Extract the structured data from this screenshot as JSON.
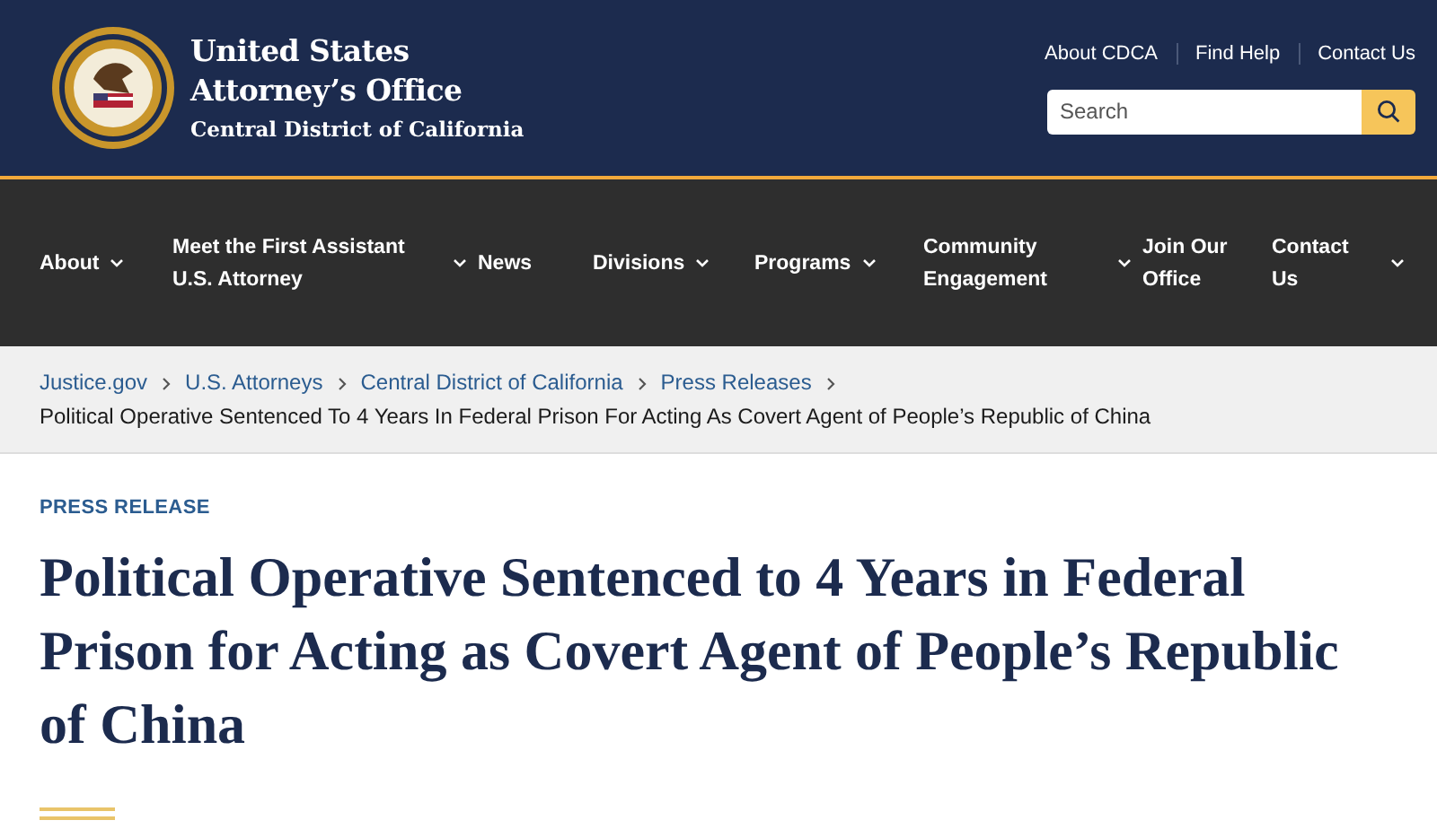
{
  "header": {
    "title_line_1": "United States",
    "title_line_2": "Attorney’s Office",
    "subtitle": "Central District of California",
    "utility_links": [
      "About CDCA",
      "Find Help",
      "Contact Us"
    ],
    "search": {
      "placeholder": "Search"
    }
  },
  "nav": [
    {
      "label": "About",
      "has_dropdown": true
    },
    {
      "label": "Meet the First Assistant U.S. Attorney",
      "has_dropdown": true
    },
    {
      "label": "News",
      "has_dropdown": false
    },
    {
      "label": "Divisions",
      "has_dropdown": true
    },
    {
      "label": "Programs",
      "has_dropdown": true
    },
    {
      "label": "Community Engagement",
      "has_dropdown": true
    },
    {
      "label": "Join Our Office",
      "has_dropdown": false
    },
    {
      "label": "Contact Us",
      "has_dropdown": true
    }
  ],
  "breadcrumb": {
    "links": [
      "Justice.gov",
      "U.S. Attorneys",
      "Central District of California",
      "Press Releases"
    ],
    "current": "Political Operative Sentenced To 4 Years In Federal Prison For Acting As Covert Agent of People’s Republic of China"
  },
  "article": {
    "eyebrow": "PRESS RELEASE",
    "title": "Political Operative Sentenced to 4 Years in Federal Prison for Acting as Covert Agent of People’s Republic of China"
  }
}
